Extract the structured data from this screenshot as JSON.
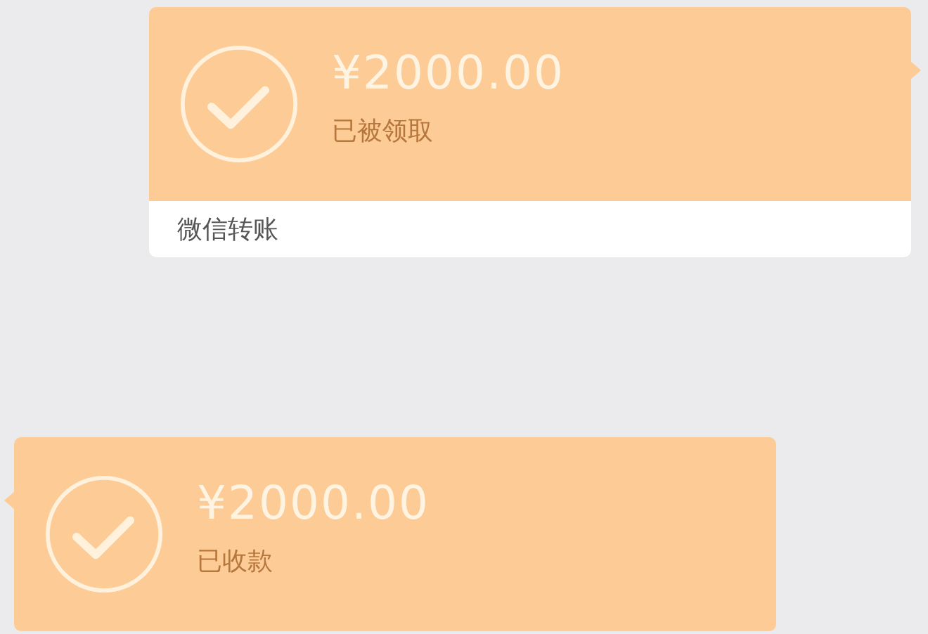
{
  "messages": [
    {
      "outgoing": true,
      "amount": "¥2000.00",
      "status": "已被领取",
      "footer": "微信转账"
    },
    {
      "outgoing": false,
      "amount": "¥2000.00",
      "status": "已收款"
    }
  ]
}
